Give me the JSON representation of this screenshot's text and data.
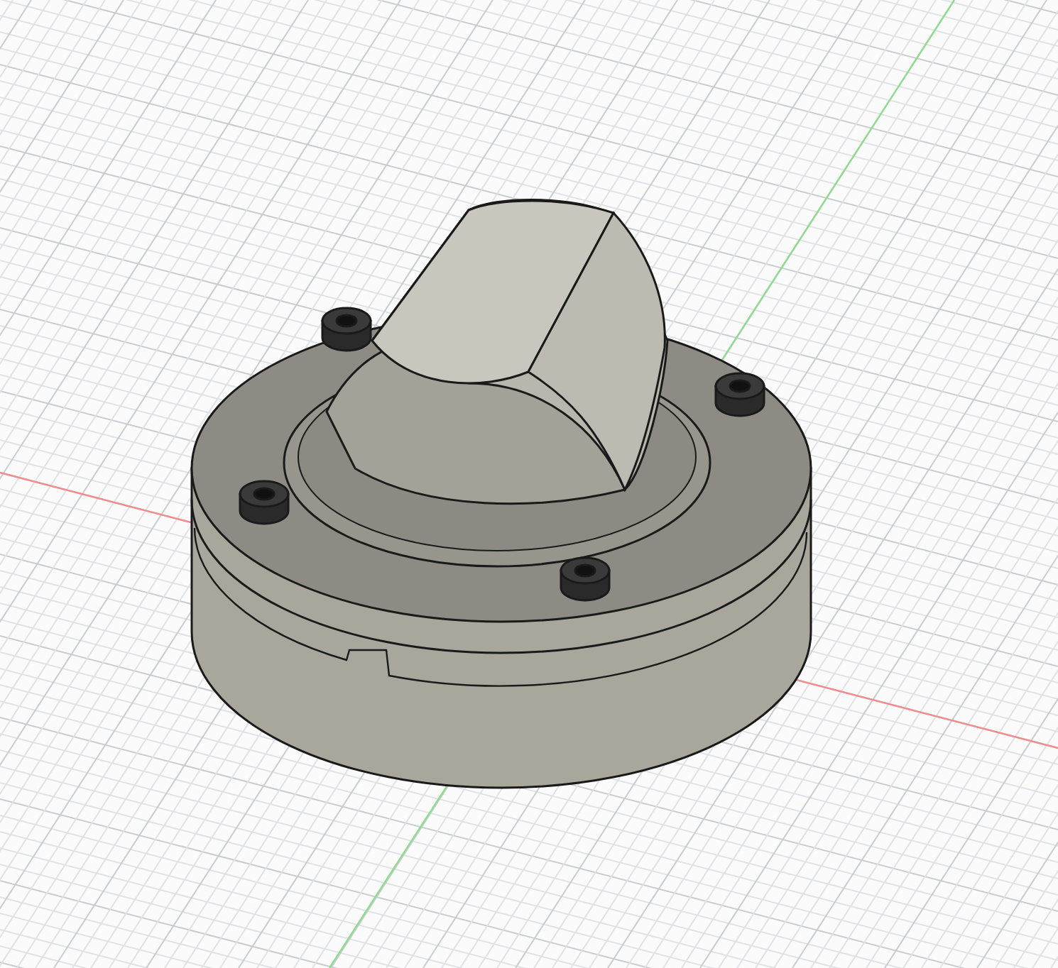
{
  "viewport": {
    "grid": true,
    "axes": [
      {
        "color": "#f28b8b"
      },
      {
        "color": "#8fdc8f"
      }
    ]
  }
}
